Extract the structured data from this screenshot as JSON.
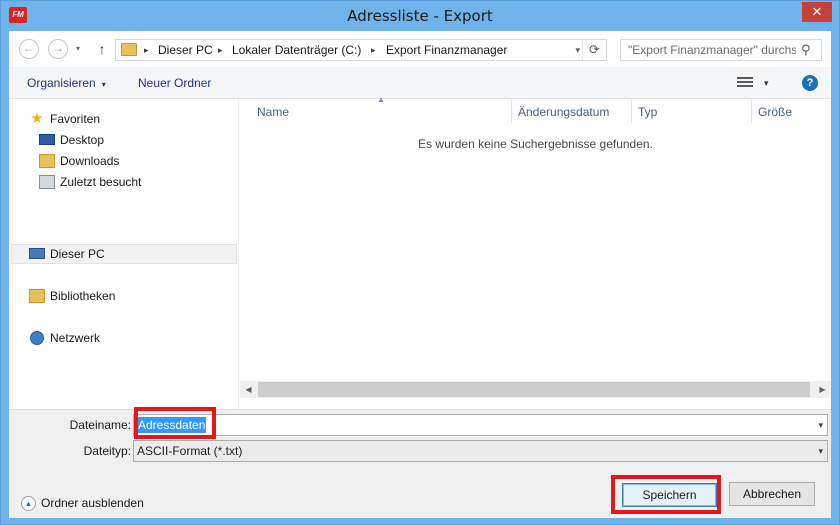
{
  "window": {
    "app_icon_text": "FM",
    "title": "Adressliste - Export",
    "close_glyph": "✕"
  },
  "navigation": {
    "back_glyph": "←",
    "forward_glyph": "→",
    "recent_glyph": "▾",
    "up_glyph": "↑",
    "breadcrumb": [
      "Dieser PC",
      "Lokaler Datenträger (C:)",
      "Export Finanzmanager"
    ],
    "separator_glyph": "▸",
    "dropdown_glyph": "▾",
    "refresh_glyph": "⟳",
    "search_placeholder": "\"Export Finanzmanager\" durchsuchen",
    "search_glyph": "⚲"
  },
  "toolbar": {
    "organize_label": "Organisieren",
    "organize_caret": "▾",
    "new_folder_label": "Neuer Ordner",
    "view_caret": "▾",
    "help_glyph": "?"
  },
  "nav_pane": {
    "favorites": {
      "label": "Favoriten",
      "glyph": "★"
    },
    "favorite_items": [
      {
        "label": "Desktop",
        "icon": "desktop-icon"
      },
      {
        "label": "Downloads",
        "icon": "downloads-folder-icon"
      },
      {
        "label": "Zuletzt besucht",
        "icon": "recent-places-icon"
      }
    ],
    "this_pc": "Dieser PC",
    "libraries": "Bibliotheken",
    "network": "Netzwerk"
  },
  "file_list": {
    "columns": [
      "Name",
      "Änderungsdatum",
      "Typ",
      "Größe"
    ],
    "sort_glyph": "▲",
    "empty_message": "Es wurden keine Suchergebnisse gefunden.",
    "scroll_left_glyph": "◀",
    "scroll_right_glyph": "▶"
  },
  "save_panel": {
    "filename_label": "Dateiname:",
    "filename_value": "Adressdaten",
    "filetype_label": "Dateityp:",
    "filetype_value": "ASCII-Format (*.txt)",
    "dropdown_glyph": "▾",
    "hide_folders_glyph": "▲",
    "hide_folders_label": "Ordner ausblenden",
    "save_label": "Speichern",
    "cancel_label": "Abbrechen"
  },
  "colors": {
    "window_frame": "#6eb4eb",
    "close_button": "#c7413b",
    "highlight_box": "#e8141e",
    "selection": "#3399ff"
  }
}
